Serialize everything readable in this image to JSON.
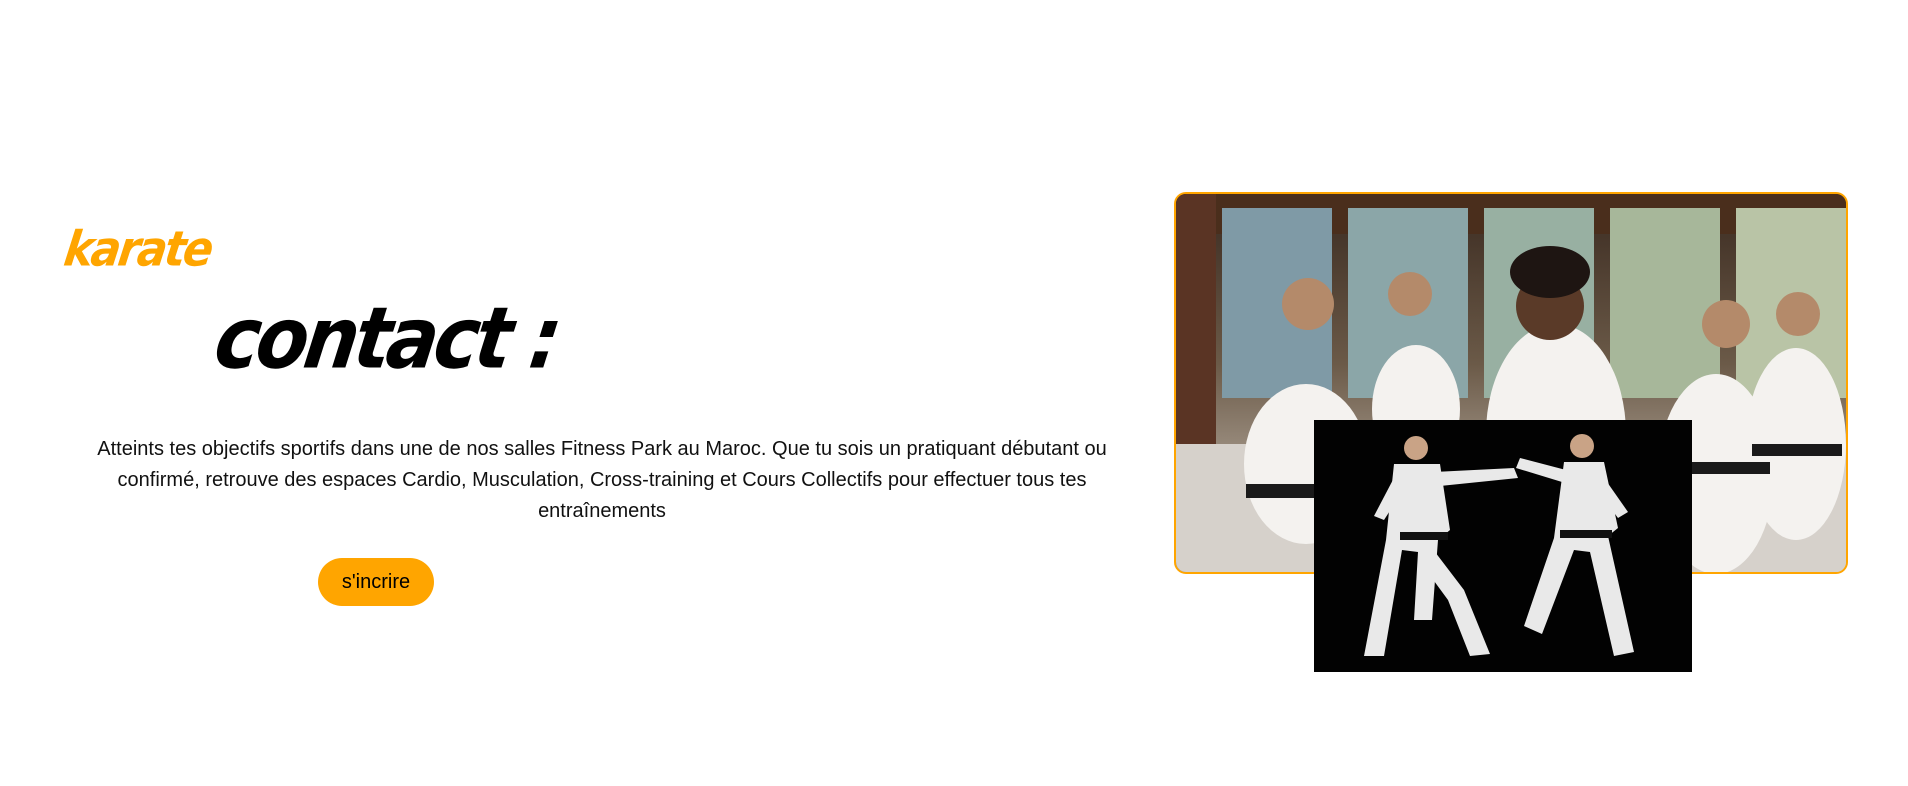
{
  "hero": {
    "brand": "karate",
    "heading": "contact :",
    "description": "Atteints tes objectifs sportifs dans une de nos salles Fitness Park au Maroc. Que tu sois un pratiquant débutant ou confirmé, retrouve des espaces Cardio, Musculation, Cross-training et Cours Collectifs pour effectuer tous tes entraînements",
    "button_label": "s'incrire"
  },
  "images": {
    "group_class": "karate-class-photo",
    "sparring": "karate-sparring-photo"
  },
  "colors": {
    "accent": "#ffa500",
    "text": "#111111",
    "background": "#ffffff"
  }
}
